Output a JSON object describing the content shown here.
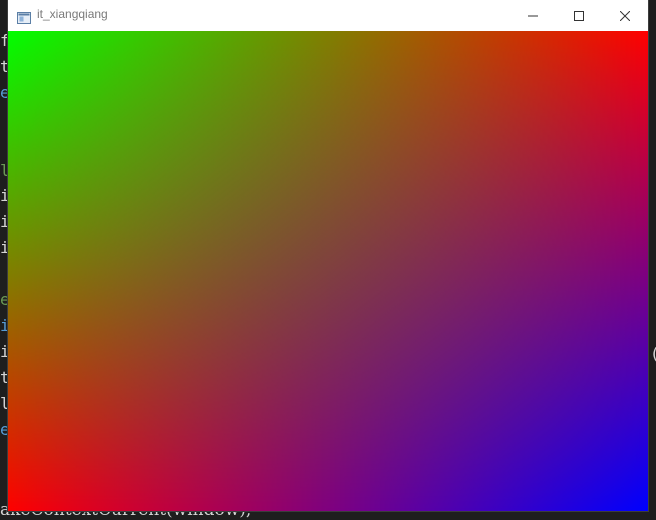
{
  "editor": {
    "left_glyphs": [
      {
        "char": "f",
        "color": "#d4d4d4"
      },
      {
        "char": "t",
        "color": "#d4d4d4"
      },
      {
        "char": "e",
        "color": "#569cd6"
      },
      {
        "char": "",
        "color": "#d4d4d4"
      },
      {
        "char": "",
        "color": "#d4d4d4"
      },
      {
        "char": "l",
        "color": "#6a9955"
      },
      {
        "char": "i",
        "color": "#d4d4d4"
      },
      {
        "char": "i",
        "color": "#d4d4d4"
      },
      {
        "char": "i",
        "color": "#d4d4d4"
      },
      {
        "char": "",
        "color": "#d4d4d4"
      },
      {
        "char": "e",
        "color": "#6a9955"
      },
      {
        "char": "i",
        "color": "#569cd6"
      },
      {
        "char": "i",
        "color": "#d4d4d4"
      },
      {
        "char": "t",
        "color": "#d4d4d4"
      },
      {
        "char": "l",
        "color": "#d4d4d4"
      },
      {
        "char": "e",
        "color": "#569cd6"
      }
    ],
    "bottom_line": "akeContextCurrent(window);",
    "right_glyph": "("
  },
  "window": {
    "title": "it_xiangqiang",
    "icon": "app-window-icon",
    "controls": {
      "minimize_icon": "minimize-icon",
      "maximize_icon": "maximize-icon",
      "close_icon": "close-icon"
    }
  },
  "render": {
    "corner_colors": {
      "top_left": "#00ff00",
      "top_right": "#ff0000",
      "bottom_left": "#ff0000",
      "bottom_right": "#0000ff"
    }
  }
}
